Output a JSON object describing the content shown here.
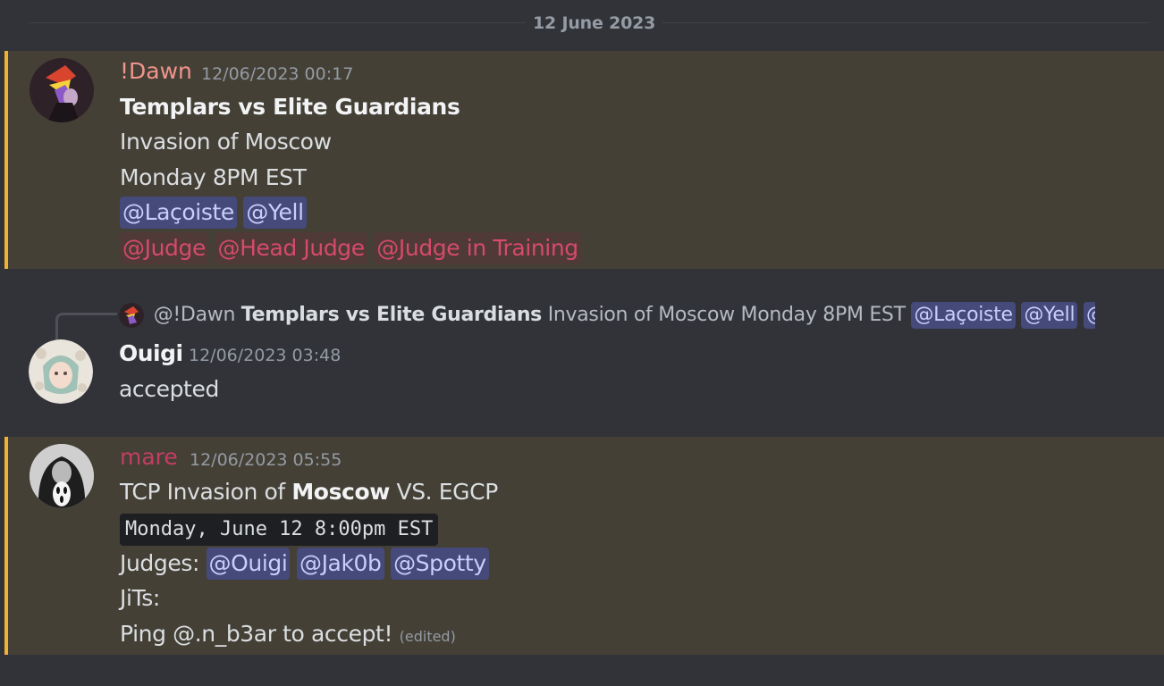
{
  "date_divider": "12 June 2023",
  "messages": [
    {
      "author": "!Dawn",
      "author_color": "#f0948c",
      "timestamp": "12/06/2023 00:17",
      "title": "Templars vs Elite Guardians",
      "line2": "Invasion of Moscow",
      "line3": "Monday 8PM EST",
      "user_mentions": [
        "@Laçoiste",
        "@Yell"
      ],
      "role_mentions": [
        "@Judge",
        "@Head Judge",
        "@Judge in Training"
      ]
    },
    {
      "reply": {
        "author": "@!Dawn",
        "title": "Templars vs Elite Guardians",
        "text": "Invasion of Moscow Monday 8PM EST",
        "mentions": [
          "@Laçoiste",
          "@Yell",
          "@J"
        ]
      },
      "author": "Ouigi",
      "author_color": "#f2f3f5",
      "timestamp": "12/06/2023 03:48",
      "text": "accepted"
    },
    {
      "author": "mare",
      "author_color": "#c43d63",
      "timestamp": "12/06/2023 05:55",
      "line1_prefix": "TCP Invasion of ",
      "line1_bold": "Moscow",
      "line1_suffix": " VS. EGCP",
      "code": "Monday, June 12 8:00pm EST",
      "judges_label": "Judges: ",
      "judges": [
        "@Ouigi",
        "@Jak0b",
        "@Spotty"
      ],
      "jits_label": "JiTs:",
      "ping_text": "Ping @.n_b3ar to accept!",
      "edited": "(edited)"
    }
  ],
  "colors": {
    "background": "#313338",
    "mention_highlight": "#444036",
    "mention_bar": "#f0b232",
    "user_mention": "#c9cdfb",
    "role_mention": "#d64a6a"
  }
}
